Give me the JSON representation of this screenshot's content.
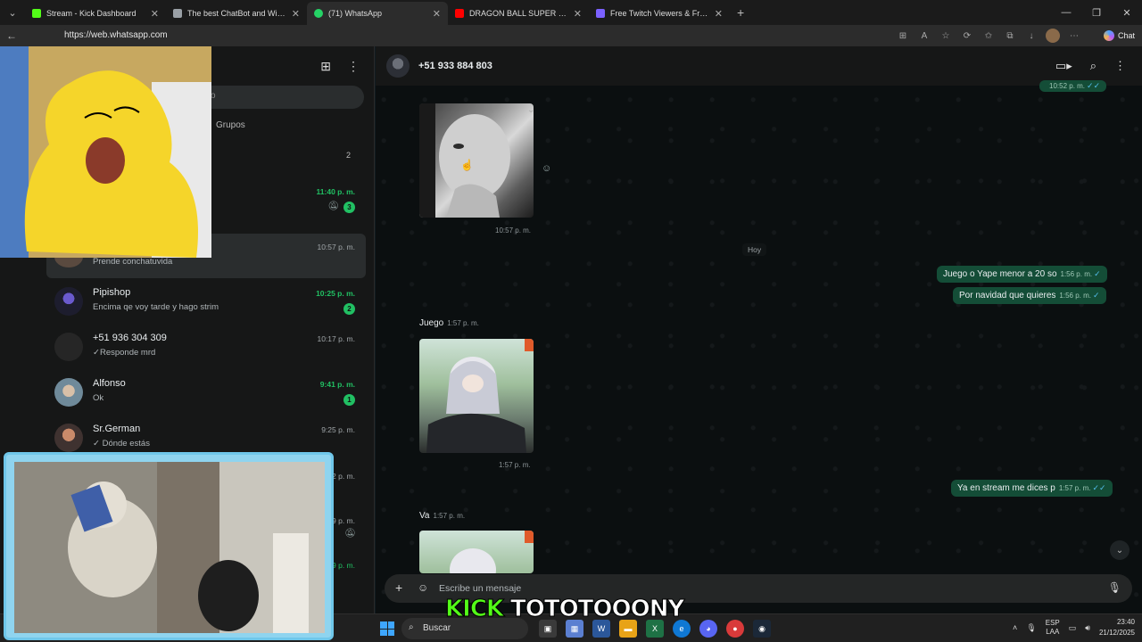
{
  "browser": {
    "tabs": [
      {
        "title": "Stream - Kick Dashboard",
        "favicon_color": "#53fc18"
      },
      {
        "title": "The best ChatBot and Widgets for",
        "favicon_color": "#9aa0a6"
      },
      {
        "title": "(71) WhatsApp",
        "favicon_color": "#25d366"
      },
      {
        "title": "DRAGON BALL SUPER OP 2 -",
        "favicon_color": "#ff0000"
      },
      {
        "title": "Free Twitch Viewers & Free Kick V",
        "favicon_color": "#7b61ff"
      }
    ],
    "url": "https://web.whatsapp.com",
    "copilot_label": "Chat"
  },
  "sidebar": {
    "search_placeholder_fragment": "o",
    "filter_chip": "Grupos",
    "archived_count": "2",
    "chats": [
      {
        "name": "",
        "last": "",
        "time": "11:40 p. m.",
        "time_green": true,
        "badge": "3",
        "muted": true
      },
      {
        "name": "",
        "last": "Prende conchatuvida",
        "time": "10:57 p. m.",
        "time_green": false,
        "badge": "",
        "muted": false
      },
      {
        "name": "Pipishop",
        "last": "Encima qe voy tarde y hago strim",
        "time": "10:25 p. m.",
        "time_green": true,
        "badge": "2",
        "muted": false
      },
      {
        "name": "+51 936 304 309",
        "last": "✓Responde mrd",
        "time": "10:17 p. m.",
        "time_green": false,
        "badge": "",
        "muted": false
      },
      {
        "name": "Alfonso",
        "last": "Ok",
        "time": "9:41 p. m.",
        "time_green": true,
        "badge": "1",
        "muted": false
      },
      {
        "name": "Sr.German",
        "last": "✓ Dónde estás",
        "time": "9:25 p. m.",
        "time_green": false,
        "badge": "",
        "muted": false
      }
    ],
    "partial_times": [
      "2 p. m.",
      "9 p. m.",
      "9 p. m."
    ]
  },
  "chat": {
    "contact": "+51 933 884 803",
    "top_time": "10:52 p. m.",
    "image1_time": "10:57 p. m.",
    "day_separator": "Hoy",
    "out1": {
      "text": "Juego o Yape menor a 20 so",
      "time": "1:56 p. m."
    },
    "out2": {
      "text": "Por navidad que quieres",
      "time": "1:56 p. m."
    },
    "in1": {
      "text": "Juego",
      "time": "1:57 p. m."
    },
    "image2_time": "1:57 p. m.",
    "out3": {
      "text": "Ya en stream me dices p",
      "time": "1:57 p. m."
    },
    "in2": {
      "text": "Va",
      "time": "1:57 p. m."
    },
    "composer_placeholder": "Escribe un mensaje"
  },
  "taskbar": {
    "search_label": "Buscar",
    "lang_top": "ESP",
    "lang_bottom": "LAA",
    "time": "23:40",
    "date": "21/12/2025"
  },
  "overlay": {
    "kick_logo": "KICK",
    "streamer_name": "TOTOTOOONY"
  }
}
